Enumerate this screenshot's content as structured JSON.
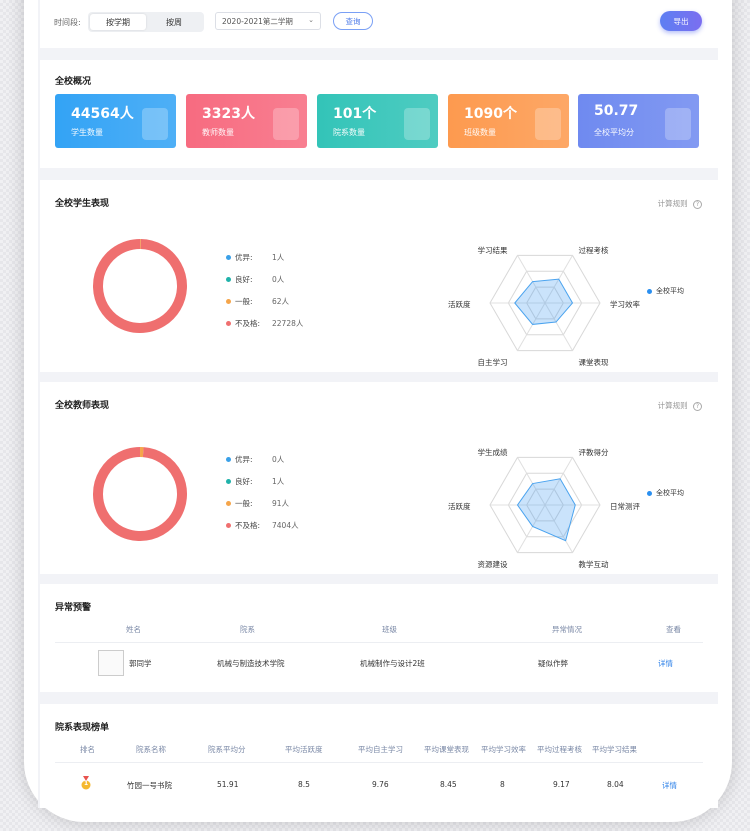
{
  "filter": {
    "time_label": "时间段:",
    "seg_semester": "按学期",
    "seg_week": "按周",
    "semester_value": "2020-2021第二学期",
    "query_label": "查询",
    "export_label": "导出"
  },
  "overview": {
    "title": "全校概况",
    "stats": [
      {
        "value": "44564人",
        "label": "学生数量",
        "color": "#33a3f5"
      },
      {
        "value": "3323人",
        "label": "教师数量",
        "color": "#f76b80"
      },
      {
        "value": "101个",
        "label": "院系数量",
        "color": "#33c4b8"
      },
      {
        "value": "1090个",
        "label": "班级数量",
        "color": "#fd9a4f"
      },
      {
        "value": "50.77",
        "label": "全校平均分",
        "color": "#6f8af0"
      }
    ]
  },
  "student_perf": {
    "title": "全校学生表现",
    "rule_label": "计算规则",
    "legend": [
      {
        "label": "优异:",
        "value": "1人",
        "color": "#3aa0e8"
      },
      {
        "label": "良好:",
        "value": "0人",
        "color": "#20b2aa"
      },
      {
        "label": "一般:",
        "value": "62人",
        "color": "#f5a54a"
      },
      {
        "label": "不及格:",
        "value": "22728人",
        "color": "#ef6f6f"
      }
    ],
    "donut_values": [
      1,
      0,
      62,
      22728
    ],
    "radar_axes": [
      "学习结果",
      "过程考核",
      "学习效率",
      "课堂表现",
      "自主学习",
      "活跃度"
    ],
    "radar_values": [
      0.45,
      0.5,
      0.5,
      0.4,
      0.45,
      0.55
    ],
    "radar_legend": "全校平均"
  },
  "teacher_perf": {
    "title": "全校教师表现",
    "rule_label": "计算规则",
    "legend": [
      {
        "label": "优异:",
        "value": "0人",
        "color": "#3aa0e8"
      },
      {
        "label": "良好:",
        "value": "1人",
        "color": "#20b2aa"
      },
      {
        "label": "一般:",
        "value": "91人",
        "color": "#f5a54a"
      },
      {
        "label": "不及格:",
        "value": "7404人",
        "color": "#ef6f6f"
      }
    ],
    "donut_values": [
      0,
      1,
      91,
      7404
    ],
    "radar_axes": [
      "学生成绩",
      "评教得分",
      "日常测评",
      "教学互动",
      "资源建设",
      "活跃度"
    ],
    "radar_values": [
      0.45,
      0.55,
      0.55,
      0.75,
      0.45,
      0.5
    ],
    "radar_legend": "全校平均"
  },
  "alerts": {
    "title": "异常预警",
    "headers": [
      "姓名",
      "院系",
      "班级",
      "异常情况",
      "查看"
    ],
    "rows": [
      {
        "name": "郭同学",
        "dept": "机械与制造技术学院",
        "class": "机械制作与设计2班",
        "issue": "疑似作弊",
        "action": "详情"
      }
    ]
  },
  "ranking": {
    "title": "院系表现榜单",
    "headers": [
      "排名",
      "院系名称",
      "院系平均分",
      "平均活跃度",
      "平均自主学习",
      "平均课堂表现",
      "平均学习效率",
      "平均过程考核",
      "平均学习结果"
    ],
    "rows": [
      {
        "rank": "1",
        "name": "竹园一号书院",
        "avg": "51.91",
        "active": "8.5",
        "self": "9.76",
        "class": "8.45",
        "eff": "8",
        "process": "9.17",
        "result": "8.04",
        "action": "详情"
      }
    ]
  }
}
